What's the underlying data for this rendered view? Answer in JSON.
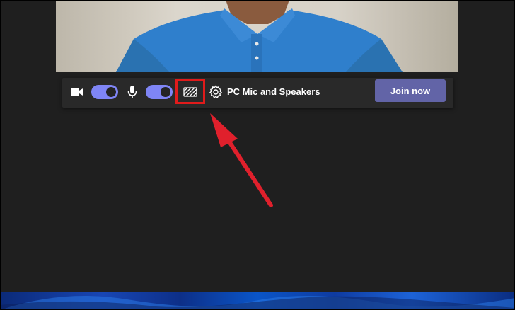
{
  "toolbar": {
    "camera_icon": "video-camera-icon",
    "camera_toggle_on": true,
    "mic_icon": "microphone-icon",
    "mic_toggle_on": true,
    "background_effects_icon": "background-effects-icon",
    "settings_icon": "gear-icon",
    "device_label": "PC Mic and Speakers",
    "join_label": "Join now"
  },
  "colors": {
    "toggle_on": "#7f85f5",
    "join_button": "#6264a7",
    "highlight_box": "#e01b1b",
    "arrow": "#e0202c",
    "background": "#1f1f1f"
  }
}
